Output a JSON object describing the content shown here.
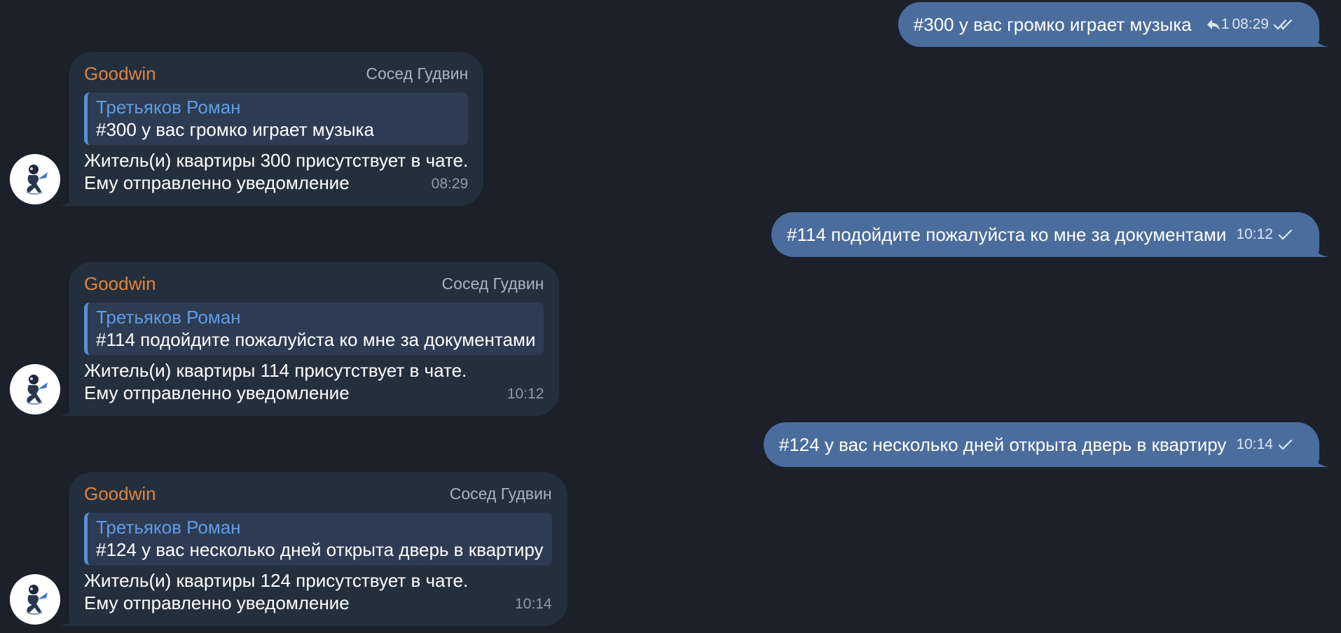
{
  "outgoing": [
    {
      "text": "#300 у вас громко играет музыка",
      "reply_count": "1",
      "time": "08:29",
      "status": "read"
    },
    {
      "text": "#114 подойдите пожалуйста ко мне за документами",
      "time": "10:12",
      "status": "sent"
    },
    {
      "text": "#124 у вас несколько дней открыта дверь в квартиру",
      "time": "10:14",
      "status": "sent"
    }
  ],
  "incoming": [
    {
      "sender": "Goodwin",
      "badge": "Сосед Гудвин",
      "quote_name": "Третьяков Роман",
      "quote_text": "#300 у вас громко играет музыка",
      "line1": "Житель(и) квартиры 300 присутствует в чате.",
      "line2": "Ему отправленно уведомление",
      "time": "08:29"
    },
    {
      "sender": "Goodwin",
      "badge": "Сосед Гудвин",
      "quote_name": "Третьяков Роман",
      "quote_text": "#114 подойдите пожалуйста ко мне за документами",
      "line1": "Житель(и) квартиры 114 присутствует в чате.",
      "line2": "Ему отправленно уведомление",
      "time": "10:12"
    },
    {
      "sender": "Goodwin",
      "badge": "Сосед Гудвин",
      "quote_name": "Третьяков Роман",
      "quote_text": "#124 у вас несколько дней открыта дверь в квартиру",
      "line1": "Житель(и) квартиры 124 присутствует в чате.",
      "line2": "Ему отправленно уведомление",
      "time": "10:14"
    }
  ],
  "colors": {
    "background": "#1b202b",
    "outgoing_bubble": "#4a6d9d",
    "incoming_bubble": "#242f3e",
    "sender_name": "#e0843a",
    "quote_name": "#5f9de6"
  },
  "icons": [
    "reply-icon",
    "double-check-icon",
    "check-icon",
    "bot-avatar"
  ]
}
